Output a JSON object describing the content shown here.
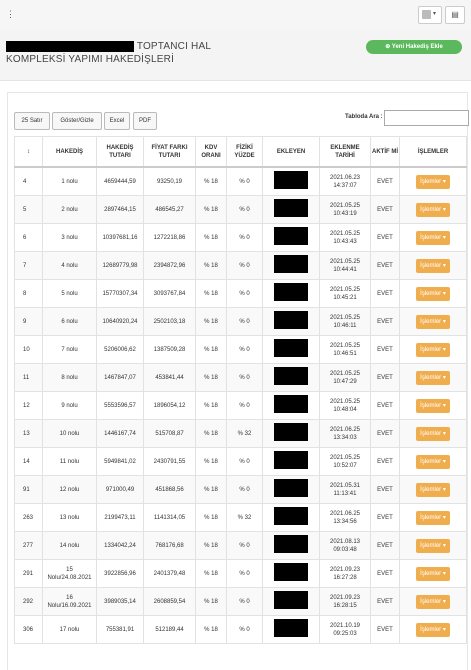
{
  "topbar": {
    "menu_icon": "kebab-menu-icon",
    "user_icon": "user-avatar-icon",
    "user_caret": "▾",
    "grid_icon": "grid-menu-icon",
    "grid_glyph": "▤"
  },
  "page": {
    "title_line1_suffix": "TOPTANCI HAL",
    "title_line2": "KOMPLEKSİ YAPIMI HAKEDİŞLERİ",
    "new_button_label": "⊕ Yeni Hakediş Ekle"
  },
  "toolbar": {
    "rows_label": "25 Satır",
    "toggle_label": "Göster/Gizle",
    "excel_label": "Excel",
    "pdf_label": "PDF",
    "search_label": "Tabloda Ara :",
    "search_value": ""
  },
  "table": {
    "headers": [
      "↕",
      "HAKEDİŞ",
      "HAKEDİŞ TUTARI",
      "FİYAT FARKI TUTARI",
      "KDV ORANI",
      "FİZİKİ YÜZDE",
      "EKLEYEN",
      "EKLENME TARİHİ",
      "AKTİF Mİ",
      "İŞLEMLER"
    ],
    "action_label": "İşlemler ▾",
    "rows": [
      {
        "id": "4",
        "hakedis": "1 nolu",
        "tutar": "4659444,59",
        "fark": "93250,19",
        "kdv": "% 18",
        "yuzde": "% 0",
        "tarih1": "2021.06.23",
        "tarih2": "14:37:07",
        "aktif": "EVET"
      },
      {
        "id": "5",
        "hakedis": "2 nolu",
        "tutar": "2897464,15",
        "fark": "486545,27",
        "kdv": "% 18",
        "yuzde": "% 0",
        "tarih1": "2021.05.25",
        "tarih2": "10:43:19",
        "aktif": "EVET"
      },
      {
        "id": "6",
        "hakedis": "3 nolu",
        "tutar": "10397681,16",
        "fark": "1272218,86",
        "kdv": "% 18",
        "yuzde": "% 0",
        "tarih1": "2021.05.25",
        "tarih2": "10:43:43",
        "aktif": "EVET"
      },
      {
        "id": "7",
        "hakedis": "4 nolu",
        "tutar": "12689779,98",
        "fark": "2394872,96",
        "kdv": "% 18",
        "yuzde": "% 0",
        "tarih1": "2021.05.25",
        "tarih2": "10:44:41",
        "aktif": "EVET"
      },
      {
        "id": "8",
        "hakedis": "5 nolu",
        "tutar": "15770307,34",
        "fark": "3093767,84",
        "kdv": "% 18",
        "yuzde": "% 0",
        "tarih1": "2021.05.25",
        "tarih2": "10:45:21",
        "aktif": "EVET"
      },
      {
        "id": "9",
        "hakedis": "6 nolu",
        "tutar": "10640920,24",
        "fark": "2502103,18",
        "kdv": "% 18",
        "yuzde": "% 0",
        "tarih1": "2021.05.25",
        "tarih2": "10:46:11",
        "aktif": "EVET"
      },
      {
        "id": "10",
        "hakedis": "7 nolu",
        "tutar": "5206006,62",
        "fark": "1387509,28",
        "kdv": "% 18",
        "yuzde": "% 0",
        "tarih1": "2021.05.25",
        "tarih2": "10:46:51",
        "aktif": "EVET"
      },
      {
        "id": "11",
        "hakedis": "8 nolu",
        "tutar": "1467847,07",
        "fark": "453841,44",
        "kdv": "% 18",
        "yuzde": "% 0",
        "tarih1": "2021.05.25",
        "tarih2": "10:47:29",
        "aktif": "EVET"
      },
      {
        "id": "12",
        "hakedis": "9 nolu",
        "tutar": "5553596,57",
        "fark": "1896054,12",
        "kdv": "% 18",
        "yuzde": "% 0",
        "tarih1": "2021.05.25",
        "tarih2": "10:48:04",
        "aktif": "EVET"
      },
      {
        "id": "13",
        "hakedis": "10 nolu",
        "tutar": "1446167,74",
        "fark": "515708,87",
        "kdv": "% 18",
        "yuzde": "% 32",
        "tarih1": "2021.06.25",
        "tarih2": "13:34:03",
        "aktif": "EVET"
      },
      {
        "id": "14",
        "hakedis": "11 nolu",
        "tutar": "5949841,02",
        "fark": "2430791,55",
        "kdv": "% 18",
        "yuzde": "% 0",
        "tarih1": "2021.05.25",
        "tarih2": "10:52:07",
        "aktif": "EVET"
      },
      {
        "id": "91",
        "hakedis": "12 nolu",
        "tutar": "971000,49",
        "fark": "451868,56",
        "kdv": "% 18",
        "yuzde": "% 0",
        "tarih1": "2021.05.31",
        "tarih2": "11:13:41",
        "aktif": "EVET"
      },
      {
        "id": "263",
        "hakedis": "13 nolu",
        "tutar": "2199473,11",
        "fark": "1141314,05",
        "kdv": "% 18",
        "yuzde": "% 32",
        "tarih1": "2021.06.25",
        "tarih2": "13:34:56",
        "aktif": "EVET"
      },
      {
        "id": "277",
        "hakedis": "14 nolu",
        "tutar": "1334042,24",
        "fark": "768176,68",
        "kdv": "% 18",
        "yuzde": "% 0",
        "tarih1": "2021.08.13",
        "tarih2": "09:03:48",
        "aktif": "EVET"
      },
      {
        "id": "291",
        "hakedis": "15 Nolu/24.08.2021",
        "tutar": "3922856,96",
        "fark": "2401379,48",
        "kdv": "% 18",
        "yuzde": "% 0",
        "tarih1": "2021.09.23",
        "tarih2": "16:27:28",
        "aktif": "EVET"
      },
      {
        "id": "292",
        "hakedis": "16 Nolu/16.09.2021",
        "tutar": "3989035,14",
        "fark": "2608859,54",
        "kdv": "% 18",
        "yuzde": "% 0",
        "tarih1": "2021.09.23",
        "tarih2": "16:28:15",
        "aktif": "EVET"
      },
      {
        "id": "306",
        "hakedis": "17 nolu",
        "tutar": "755381,91",
        "fark": "512189,44",
        "kdv": "% 18",
        "yuzde": "% 0",
        "tarih1": "2021.10.19",
        "tarih2": "09:25:03",
        "aktif": "EVET"
      }
    ]
  }
}
